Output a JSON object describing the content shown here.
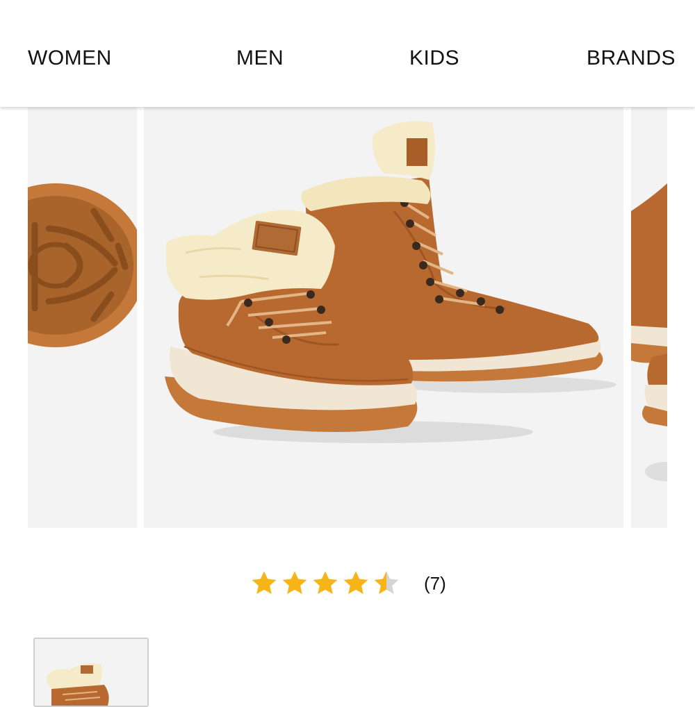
{
  "nav": {
    "items": [
      {
        "label": "WOMEN"
      },
      {
        "label": "MEN"
      },
      {
        "label": "KIDS"
      },
      {
        "label": "BRANDS"
      }
    ]
  },
  "product": {
    "rating": {
      "value": 4.5,
      "max": 5,
      "count_label": "(7)",
      "star_color": "#F6B418",
      "empty_star_color": "#D5D5D5"
    },
    "colors": {
      "suede": "#B8692F",
      "shearling": "#F6EBC8",
      "sole": "#F1E6D3",
      "outsole": "#C4793A"
    }
  }
}
